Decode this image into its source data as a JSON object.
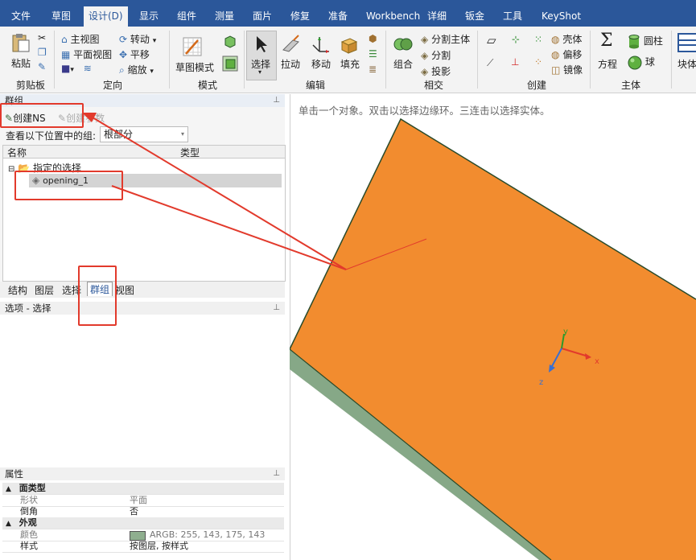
{
  "menubar": {
    "items": [
      "文件",
      "草图",
      "设计(D)",
      "显示",
      "组件",
      "测量",
      "面片",
      "修复",
      "准备",
      "Workbench",
      "详细",
      "钣金",
      "工具",
      "KeyShot"
    ],
    "active_index": 2
  },
  "ribbon": {
    "clipboard": {
      "paste": "粘贴",
      "label": "剪贴板"
    },
    "orient": {
      "home_view": "主视图",
      "plan_view": "平面视图",
      "rotate": "转动",
      "pan": "平移",
      "zoom": "缩放",
      "label": "定向"
    },
    "mode": {
      "sketch_mode": "草图模式",
      "label": "模式"
    },
    "edit": {
      "select": "选择",
      "pull": "拉动",
      "move": "移动",
      "fill": "填充",
      "label": "编辑"
    },
    "intersect": {
      "combine": "组合",
      "split_body": "分割主体",
      "split": "分割",
      "project": "投影",
      "label": "相交"
    },
    "create": {
      "shell": "壳体",
      "offset": "偏移",
      "mirror": "镜像",
      "label": "创建"
    },
    "body": {
      "equation": "方程",
      "cylinder": "圆柱",
      "sphere": "球",
      "label": "主体"
    },
    "extra": {
      "block": "块体"
    }
  },
  "groups_pane": {
    "title": "群组",
    "create_ns": "创建NS",
    "create_param": "创建参数",
    "view_groups_label": "查看以下位置中的组:",
    "location_value": "根部分",
    "col_name": "名称",
    "col_type": "类型",
    "tree": {
      "folder": "指定的选择",
      "item": "opening_1"
    }
  },
  "tabs": {
    "items": [
      "结构",
      "图层",
      "选择",
      "群组",
      "视图"
    ],
    "active_index": 3
  },
  "options_pane": {
    "title": "选项 - 选择"
  },
  "properties": {
    "title": "属性",
    "rows": [
      {
        "category": "面类型"
      },
      {
        "key": "形状",
        "value": "平面"
      },
      {
        "key": "倒角",
        "value": "否"
      },
      {
        "category": "外观"
      },
      {
        "key": "颜色",
        "value": "ARGB: 255, 143, 175, 143",
        "swatch": "#8faf8f"
      },
      {
        "key": "样式",
        "value": "按图层, 按样式"
      }
    ]
  },
  "viewport": {
    "hint": "单击一个对象。双击以选择边缘环。三连击以选择实体。",
    "axes": {
      "x": "x",
      "y": "y",
      "z": "z"
    },
    "colors": {
      "top_face": "#f28c2f",
      "side_face": "#86a887",
      "edge": "#2a4a2a"
    }
  },
  "colors": {
    "menubar": "#2b579a",
    "annotation": "#e23a2c"
  }
}
